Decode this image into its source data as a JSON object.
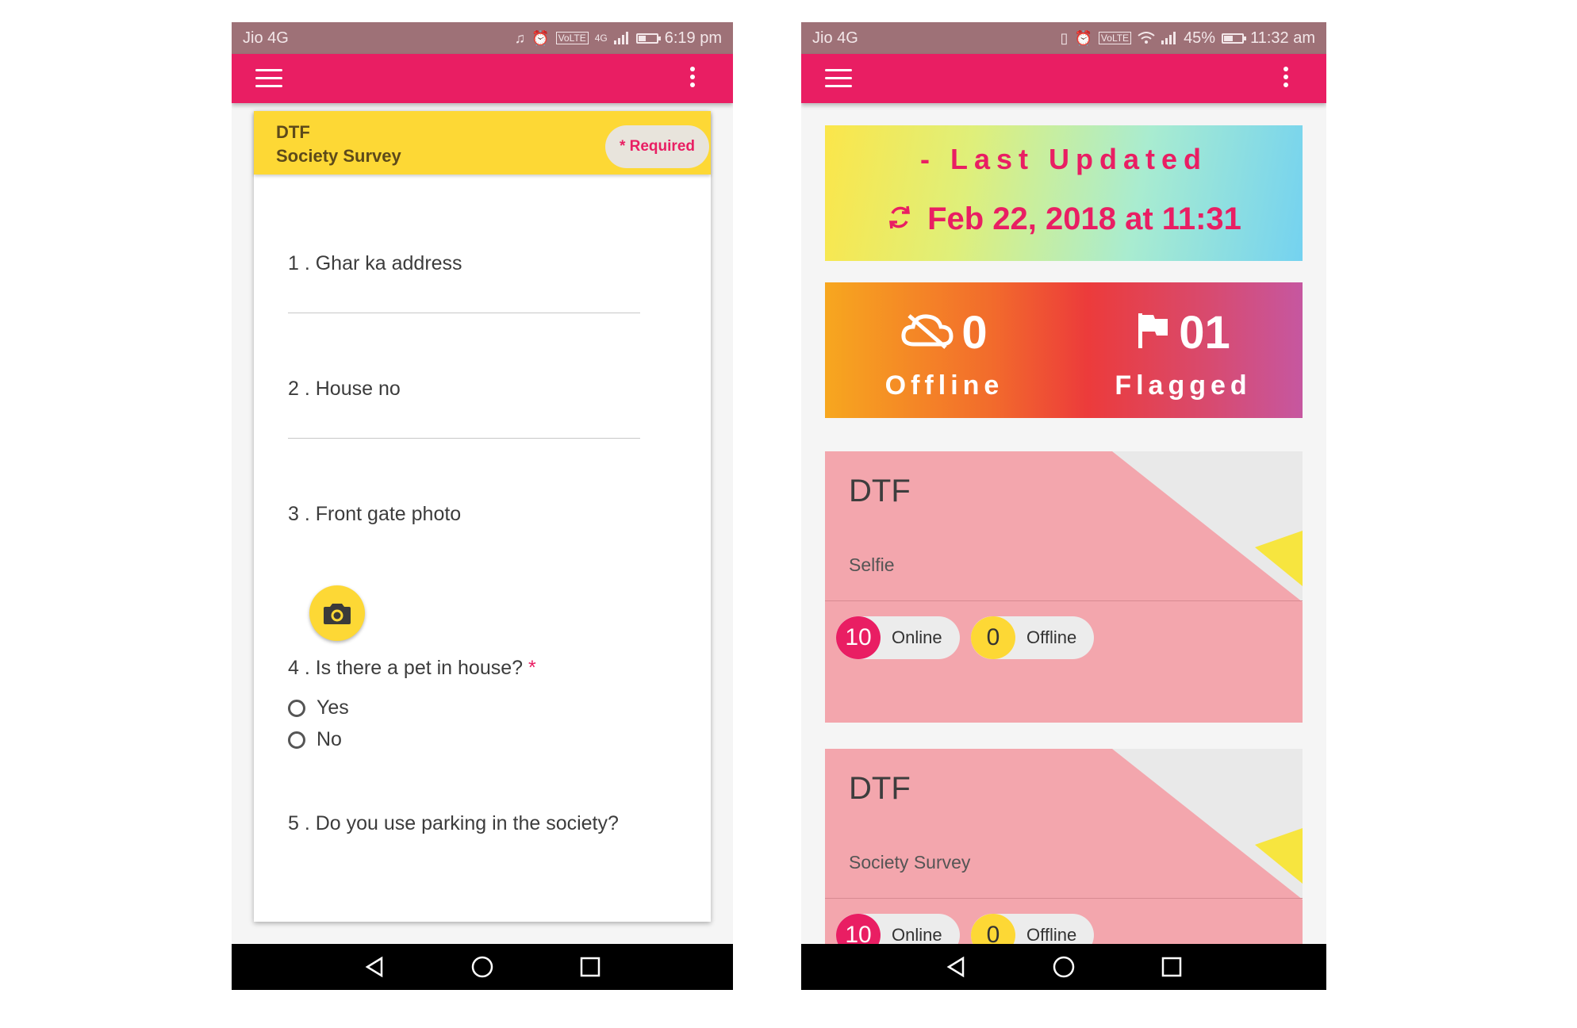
{
  "screen_a": {
    "status": {
      "carrier": "Jio 4G",
      "time": "6:19 pm",
      "network": "4G",
      "volte": "VoLTE"
    },
    "form": {
      "title_line1": "DTF",
      "title_line2": "Society Survey",
      "required_label": "Required",
      "required_star": "*",
      "q1": "1 . Ghar ka address",
      "q2": "2 . House no",
      "q3": "3 . Front gate photo",
      "q4": "4 . Is there a pet in house?",
      "q4_star": "*",
      "q4_options": [
        "Yes",
        "No"
      ],
      "q5": "5 . Do you use parking in the society?"
    }
  },
  "screen_b": {
    "status": {
      "carrier": "Jio 4G",
      "time": "11:32 am",
      "battery": "45%",
      "battery_level": 0.45,
      "volte": "VoLTE"
    },
    "last_updated": {
      "label": "- Last Updated",
      "value": "Feb 22, 2018 at 11:31"
    },
    "stats": {
      "offline_count": "0",
      "offline_label": "Offline",
      "flagged_count": "01",
      "flagged_label": "Flagged"
    },
    "tiles": [
      {
        "org": "DTF",
        "form": "Selfie",
        "online_count": "10",
        "online_label": "Online",
        "offline_count": "0",
        "offline_label": "Offline"
      },
      {
        "org": "DTF",
        "form": "Society Survey",
        "online_count": "10",
        "online_label": "Online",
        "offline_count": "0",
        "offline_label": "Offline"
      }
    ]
  },
  "colors": {
    "primary": "#e91e63",
    "accent": "#fdd835",
    "statusbar": "#9e7177",
    "tile": "#f3a6ad"
  },
  "icons": [
    "menu-icon",
    "more-vert-icon",
    "camera-icon",
    "sync-icon",
    "cloud-off-icon",
    "flag-icon",
    "nav-back-icon",
    "nav-home-icon",
    "nav-recents-icon"
  ]
}
